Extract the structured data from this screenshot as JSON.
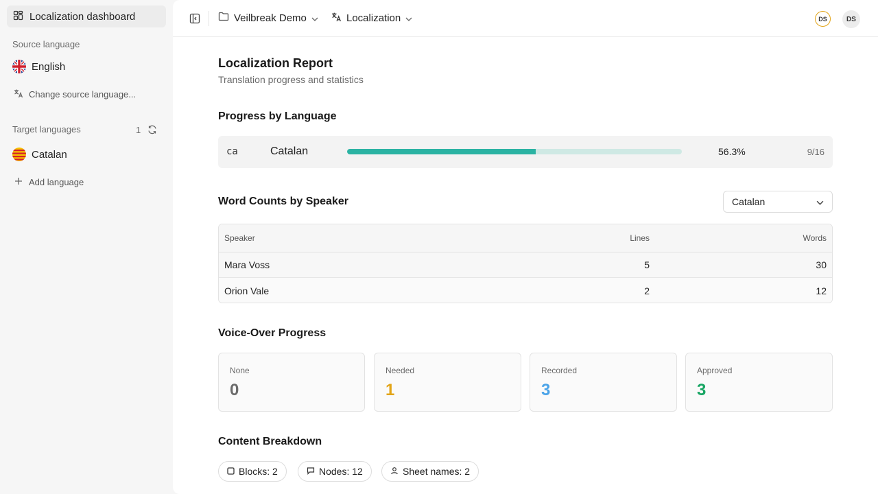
{
  "sidebar": {
    "dashboard_label": "Localization dashboard",
    "source_section_label": "Source language",
    "source_language": "English",
    "change_source_label": "Change source language...",
    "target_section_label": "Target languages",
    "target_count": "1",
    "target_languages": [
      {
        "name": "Catalan"
      }
    ],
    "add_language_label": "Add language"
  },
  "topbar": {
    "project_label": "Veilbreak Demo",
    "mode_label": "Localization",
    "avatar_1": "DS",
    "avatar_2": "DS"
  },
  "report": {
    "title": "Localization Report",
    "subtitle": "Translation progress and statistics"
  },
  "progress": {
    "heading": "Progress by Language",
    "rows": [
      {
        "code": "ca",
        "language": "Catalan",
        "percent": 56.3,
        "percent_label": "56.3%",
        "fraction": "9/16"
      }
    ]
  },
  "word_counts": {
    "heading": "Word Counts by Speaker",
    "selected_language": "Catalan",
    "columns": [
      "Speaker",
      "Lines",
      "Words"
    ],
    "rows": [
      {
        "speaker": "Mara Voss",
        "lines": "5",
        "words": "30"
      },
      {
        "speaker": "Orion Vale",
        "lines": "2",
        "words": "12"
      }
    ]
  },
  "voice_over": {
    "heading": "Voice-Over Progress",
    "cards": [
      {
        "label": "None",
        "value": "0",
        "color": "#6b6b6b"
      },
      {
        "label": "Needed",
        "value": "1",
        "color": "#e2a417"
      },
      {
        "label": "Recorded",
        "value": "3",
        "color": "#4aa3e8"
      },
      {
        "label": "Approved",
        "value": "3",
        "color": "#17a563"
      }
    ]
  },
  "content_breakdown": {
    "heading": "Content Breakdown",
    "chips": [
      {
        "label": "Blocks: 2",
        "icon": "square-icon"
      },
      {
        "label": "Nodes: 12",
        "icon": "message-icon"
      },
      {
        "label": "Sheet names: 2",
        "icon": "user-icon"
      }
    ]
  },
  "colors": {
    "progress_fill": "#2bb3a3",
    "progress_track": "#cfe9e4",
    "avatar_ring": "#e2a417"
  }
}
